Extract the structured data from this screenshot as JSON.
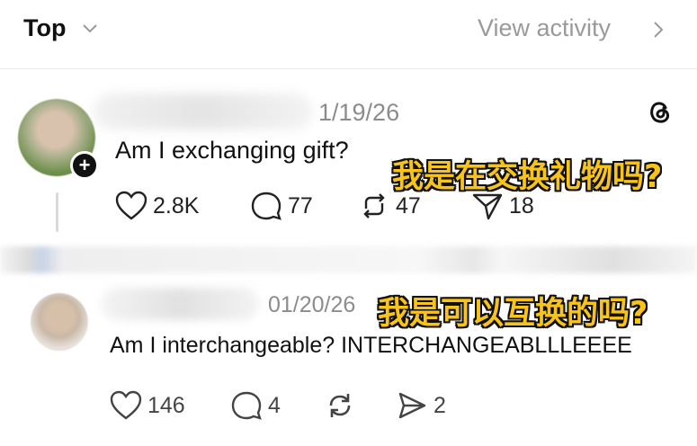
{
  "header": {
    "sort_label": "Top",
    "view_activity_label": "View activity"
  },
  "post1": {
    "date": "1/19/26",
    "text": "Am I exchanging gift?",
    "likes": "2.8K",
    "replies": "77",
    "reposts": "47",
    "shares": "18",
    "overlay": "我是在交换礼物吗?"
  },
  "post2": {
    "date": "01/20/26",
    "text": "Am I interchangeable? INTERCHANGEABLLLEEEE",
    "likes": "146",
    "replies": "4",
    "shares": "2",
    "overlay": "我是可以互换的吗?"
  },
  "icons": [
    "chevron-down-icon",
    "chevron-right-icon",
    "threads-logo-icon",
    "heart-icon",
    "comment-icon",
    "repost-icon",
    "send-icon",
    "plus-icon"
  ],
  "colors": {
    "overlay_text": "#f9c41a",
    "muted_text": "#8c8c8c"
  }
}
